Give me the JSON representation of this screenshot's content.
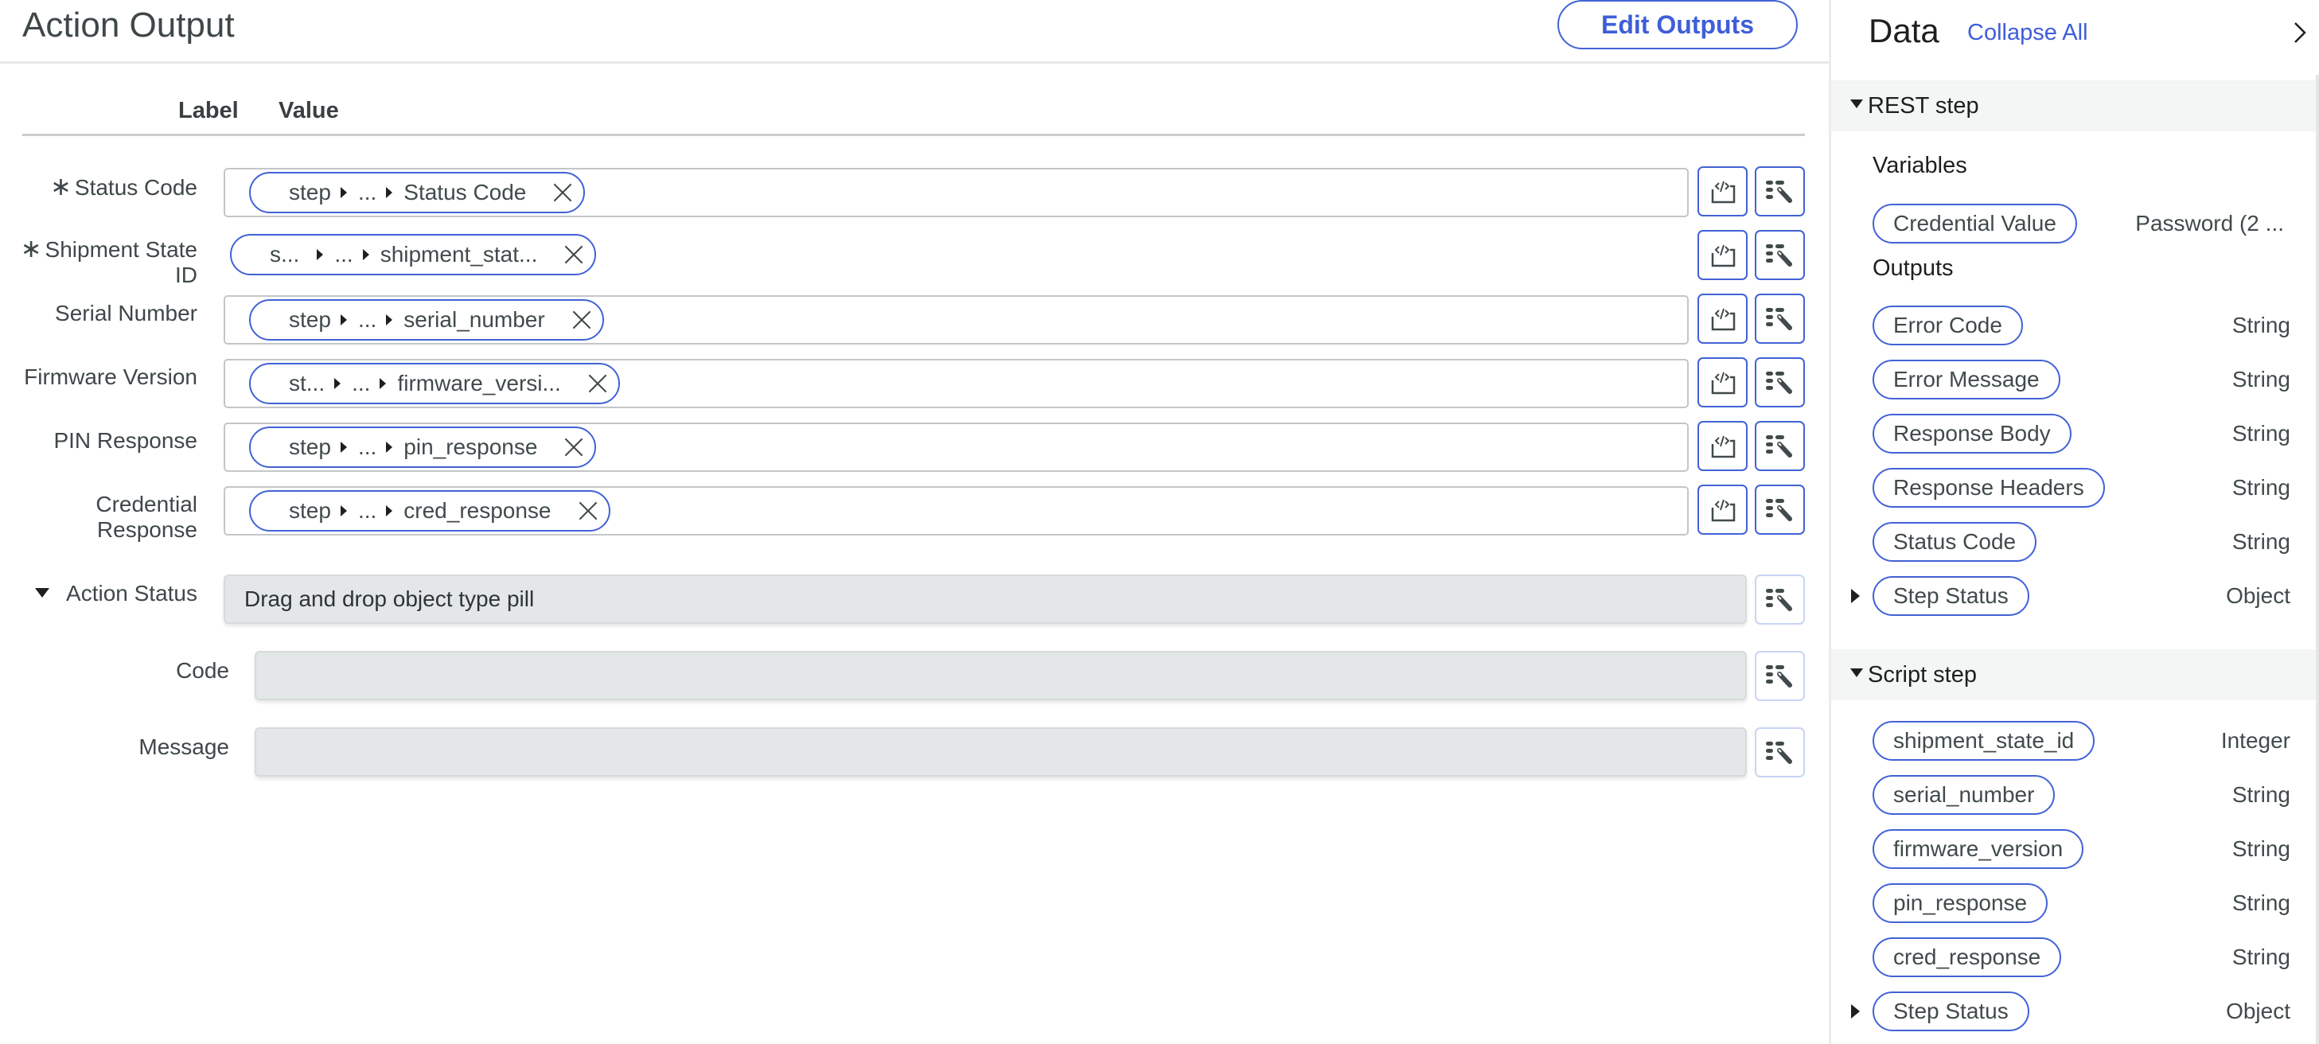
{
  "header": {
    "title": "Action Output",
    "edit_outputs_label": "Edit Outputs"
  },
  "table": {
    "label_header": "Label",
    "value_header": "Value"
  },
  "outputs": [
    {
      "label": "Status Code",
      "required": true,
      "required_mark": "∗",
      "pill": [
        "step",
        "...",
        "Status Code"
      ],
      "has_border": true
    },
    {
      "label": "Shipment State ID",
      "required": true,
      "required_mark": "∗",
      "pill": [
        "s...",
        "...",
        "shipment_stat..."
      ],
      "has_border": false
    },
    {
      "label": "Serial Number",
      "required": false,
      "pill": [
        "step",
        "...",
        "serial_number"
      ],
      "has_border": true
    },
    {
      "label": "Firmware Version",
      "required": false,
      "pill": [
        "st...",
        "...",
        "firmware_versi..."
      ],
      "has_border": true
    },
    {
      "label": "PIN Response",
      "required": false,
      "pill": [
        "step",
        "...",
        "pin_response"
      ],
      "has_border": true
    },
    {
      "label": "Credential Response",
      "required": false,
      "pill": [
        "step",
        "...",
        "cred_response"
      ],
      "has_border": true
    }
  ],
  "action_status": {
    "label": "Action Status",
    "placeholder": "Drag and drop object type pill",
    "children": [
      {
        "label": "Code",
        "value": ""
      },
      {
        "label": "Message",
        "value": ""
      }
    ]
  },
  "icons": {
    "script": "script-icon",
    "pill_picker": "data-pill-picker-icon",
    "remove": "close-icon"
  },
  "data_panel": {
    "title": "Data",
    "collapse_all_label": "Collapse All",
    "sections": [
      {
        "name": "REST step",
        "expanded": true,
        "groups": [
          {
            "label": "Variables",
            "items": [
              {
                "name": "Credential Value",
                "type": "Password (2 ..."
              }
            ]
          },
          {
            "label": "Outputs",
            "items": [
              {
                "name": "Error Code",
                "type": "String"
              },
              {
                "name": "Error Message",
                "type": "String"
              },
              {
                "name": "Response Body",
                "type": "String"
              },
              {
                "name": "Response Headers",
                "type": "String"
              },
              {
                "name": "Status Code",
                "type": "String"
              },
              {
                "name": "Step Status",
                "type": "Object",
                "expandable": true
              }
            ]
          }
        ]
      },
      {
        "name": "Script step",
        "expanded": true,
        "items": [
          {
            "name": "shipment_state_id",
            "type": "Integer"
          },
          {
            "name": "serial_number",
            "type": "String"
          },
          {
            "name": "firmware_version",
            "type": "String"
          },
          {
            "name": "pin_response",
            "type": "String"
          },
          {
            "name": "cred_response",
            "type": "String"
          },
          {
            "name": "Step Status",
            "type": "Object",
            "expandable": true
          }
        ]
      }
    ]
  },
  "colors": {
    "accent": "#4262d6",
    "link": "#3f5ed8",
    "text": "#414a4c",
    "section_bg": "#f4f5f5",
    "readonly_field_bg": "#e4e7e8"
  }
}
